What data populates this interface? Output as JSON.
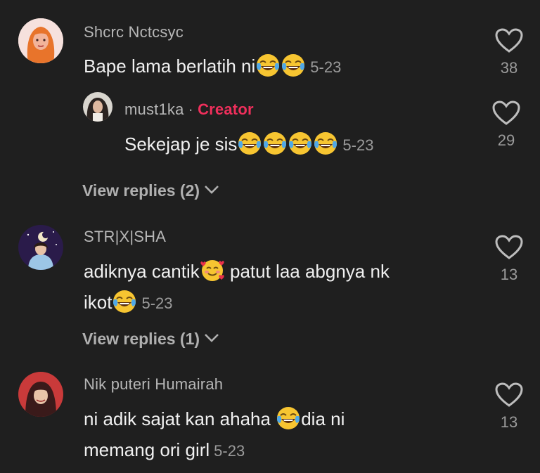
{
  "comments": [
    {
      "username": "Shcrc Nctcsyc",
      "text": "Bape lama berlatih ni",
      "emojis": [
        "laughing-crying",
        "laughing-crying"
      ],
      "date": "5-23",
      "likes": "38",
      "reply": {
        "username": "must1ka",
        "separator": "·",
        "creator_label": "Creator",
        "text": "Sekejap je sis",
        "emojis": [
          "laughing-crying",
          "laughing-crying",
          "laughing-crying",
          "laughing-crying"
        ],
        "date": "5-23",
        "likes": "29"
      },
      "view_replies": "View replies (2)"
    },
    {
      "username": "STR|X|SHA",
      "text_line1_a": "adiknya cantik",
      "text_line1_b": " patut laa abgnya nk",
      "text_line2": "ikot",
      "date": "5-23",
      "likes": "13",
      "view_replies": "View replies (1)"
    },
    {
      "username": "Nik puteri Humairah",
      "text_line1_a": "ni adik sajat kan ahaha ",
      "text_line1_b": "dia ni",
      "text_line2": "memang ori girl",
      "date": "5-23",
      "likes": "13"
    }
  ],
  "colors": {
    "background": "#1f1f1f",
    "creator": "#ee2f5b",
    "muted": "#9b9b9b"
  },
  "icons": [
    "heart-icon",
    "chevron-down-icon",
    "laughing-crying-emoji",
    "smiling-hearts-emoji"
  ]
}
